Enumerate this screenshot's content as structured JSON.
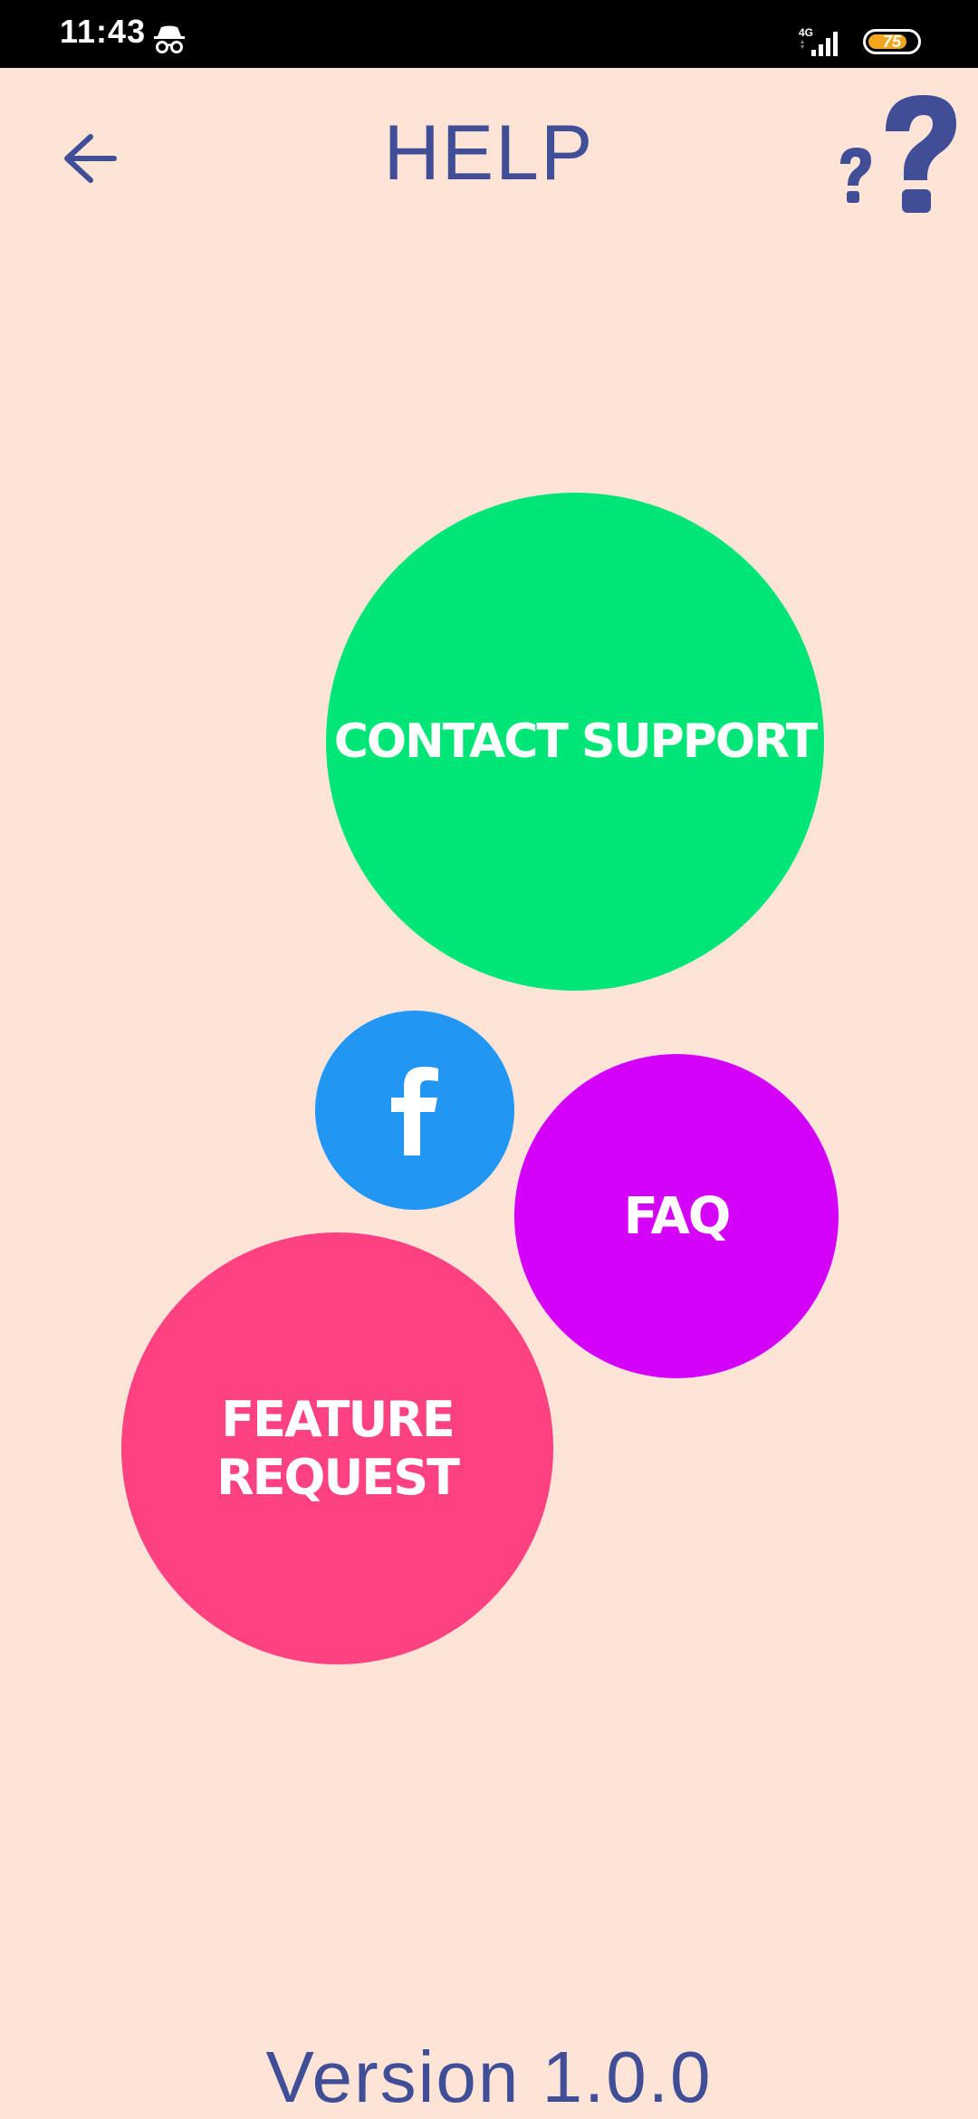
{
  "status_bar": {
    "time": "11:43",
    "incognito_icon": "incognito-icon",
    "network_label": "4G",
    "battery_level": "75"
  },
  "header": {
    "back_icon": "arrow-left-icon",
    "title": "HELP",
    "help_icon": "question-marks-icon"
  },
  "bubbles": {
    "contact_support": "CONTACT SUPPORT",
    "facebook_icon": "facebook-icon",
    "faq": "FAQ",
    "feature_request": "FEATURE\nREQUEST"
  },
  "footer": {
    "version": "Version 1.0.0"
  },
  "colors": {
    "background": "#fde4d7",
    "accent_text": "#3f4e96",
    "contact": "#00e676",
    "facebook": "#2196f3",
    "faq": "#d500f9",
    "feature": "#ff4081"
  }
}
